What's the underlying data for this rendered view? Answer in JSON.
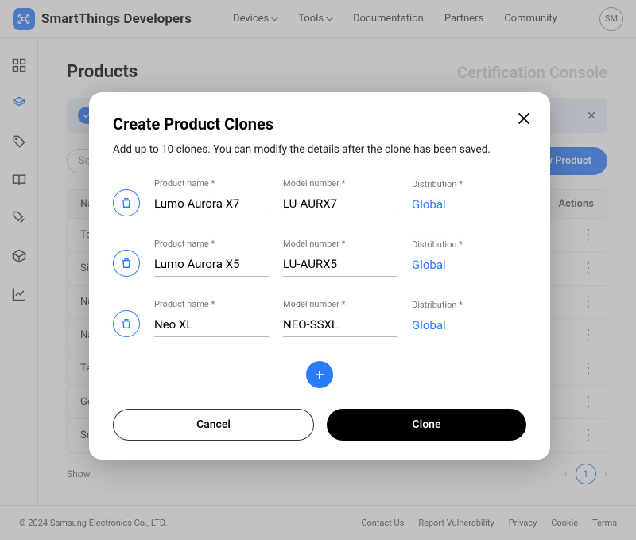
{
  "header": {
    "brand": "SmartThings Developers",
    "nav": [
      "Devices",
      "Tools",
      "Documentation",
      "Partners",
      "Community"
    ],
    "avatar": "SM"
  },
  "page": {
    "title": "Products",
    "cert": "Certification Console",
    "search_placeholder": "Se",
    "new_button": "ew Product",
    "table": {
      "head_name": "Na",
      "head_actions": "Actions",
      "rows": [
        "Te",
        "Si",
        "Na",
        "Na",
        "Te",
        "Ge",
        "Sm"
      ]
    },
    "pager": {
      "show": "Show",
      "current": "1"
    }
  },
  "modal": {
    "title": "Create Product Clones",
    "subtitle": "Add up to 10 clones. You can modify the details after the clone has been saved.",
    "labels": {
      "name": "Product name *",
      "model": "Model number *",
      "dist": "Distribution *"
    },
    "dist_value": "Global",
    "clones": [
      {
        "name": "Lumo Aurora X7",
        "model": "LU-AURX7"
      },
      {
        "name": "Lumo Aurora X5",
        "model": "LU-AURX5"
      },
      {
        "name": "Neo XL",
        "model": "NEO-SSXL"
      }
    ],
    "cancel": "Cancel",
    "clone": "Clone"
  },
  "footer": {
    "copyright": "© 2024 Samsung Electronics Co., LTD.",
    "links": [
      "Contact Us",
      "Report Vulnerability",
      "Privacy",
      "Cookie",
      "Terms"
    ]
  }
}
